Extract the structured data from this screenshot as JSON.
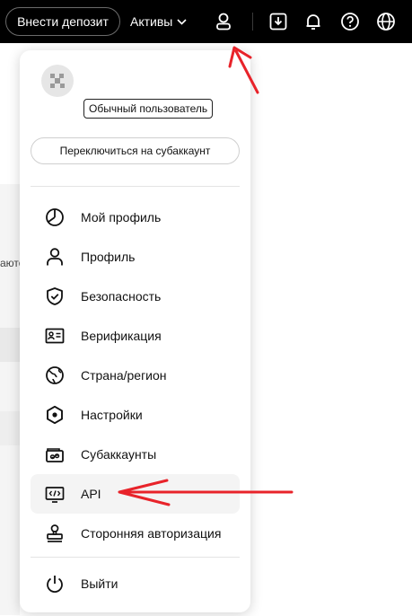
{
  "topbar": {
    "deposit_label": "Внести депозит",
    "assets_label": "Активы",
    "icons": [
      "user-icon",
      "download-icon",
      "bell-icon",
      "help-icon",
      "globe-icon"
    ]
  },
  "background": {
    "partial_text": "аюто"
  },
  "dropdown": {
    "user_badge": "Обычный пользователь",
    "switch_label": "Переключиться на субаккаунт",
    "items": [
      {
        "label": "Мой профиль",
        "icon": "pie-chart-icon"
      },
      {
        "label": "Профиль",
        "icon": "person-icon"
      },
      {
        "label": "Безопасность",
        "icon": "shield-check-icon"
      },
      {
        "label": "Верификация",
        "icon": "id-card-icon"
      },
      {
        "label": "Страна/регион",
        "icon": "globe-icon"
      },
      {
        "label": "Настройки",
        "icon": "settings-hexagon-icon"
      },
      {
        "label": "Субаккаунты",
        "icon": "wallet-link-icon"
      },
      {
        "label": "API",
        "icon": "code-icon"
      },
      {
        "label": "Сторонняя авторизация",
        "icon": "stamp-icon"
      }
    ],
    "logout_label": "Выйти"
  },
  "colors": {
    "topbar": "#000000",
    "annotation_arrow": "#e8232a",
    "hover_row": "#f4f4f4"
  }
}
